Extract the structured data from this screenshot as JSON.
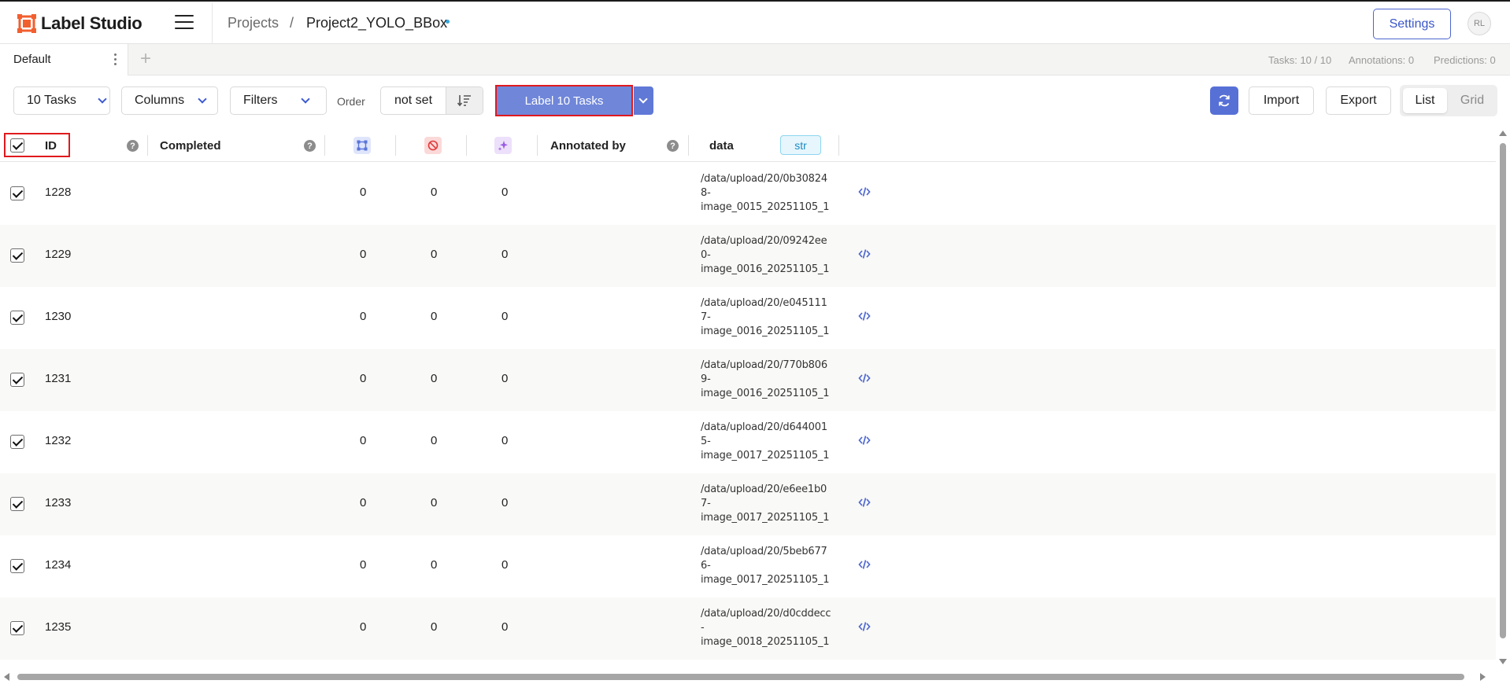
{
  "app": {
    "logo_text": "Label Studio",
    "brand_color": "#f25f2f",
    "accent_color": "#5770d6"
  },
  "header": {
    "breadcrumb_projects": "Projects",
    "breadcrumb_separator": "/",
    "project_name": "Project2_YOLO_BBox",
    "settings_label": "Settings",
    "avatar_initials": "RL"
  },
  "tabs": {
    "active_label": "Default",
    "add_label": "+",
    "stats": {
      "tasks": "Tasks: 10 / 10",
      "annotations": "Annotations: 0",
      "predictions": "Predictions: 0"
    }
  },
  "toolbar": {
    "tasks_label": "10 Tasks",
    "columns_label": "Columns",
    "filters_label": "Filters",
    "order_label": "Order",
    "order_value": "not set",
    "label_button": "Label 10 Tasks",
    "import_label": "Import",
    "export_label": "Export",
    "view_list": "List",
    "view_grid": "Grid",
    "active_view": "List"
  },
  "table": {
    "columns": {
      "id": "ID",
      "completed": "Completed",
      "annotated_by": "Annotated by",
      "data": "data",
      "data_type": "str",
      "help_glyph": "?"
    },
    "column_icons": [
      "annotations-count-icon",
      "cancelled-count-icon",
      "predictions-count-icon"
    ],
    "rows": [
      {
        "id": "1228",
        "total": "0",
        "cancelled": "0",
        "predictions": "0",
        "data": [
          "/data/upload/20/0b30824",
          "8-",
          "image_0015_20251105_1"
        ],
        "checked": true
      },
      {
        "id": "1229",
        "total": "0",
        "cancelled": "0",
        "predictions": "0",
        "data": [
          "/data/upload/20/09242ee",
          "0-",
          "image_0016_20251105_1"
        ],
        "checked": true
      },
      {
        "id": "1230",
        "total": "0",
        "cancelled": "0",
        "predictions": "0",
        "data": [
          "/data/upload/20/e045111",
          "7-",
          "image_0016_20251105_1"
        ],
        "checked": true
      },
      {
        "id": "1231",
        "total": "0",
        "cancelled": "0",
        "predictions": "0",
        "data": [
          "/data/upload/20/770b806",
          "9-",
          "image_0016_20251105_1"
        ],
        "checked": true
      },
      {
        "id": "1232",
        "total": "0",
        "cancelled": "0",
        "predictions": "0",
        "data": [
          "/data/upload/20/d644001",
          "5-",
          "image_0017_20251105_1"
        ],
        "checked": true
      },
      {
        "id": "1233",
        "total": "0",
        "cancelled": "0",
        "predictions": "0",
        "data": [
          "/data/upload/20/e6ee1b0",
          "7-",
          "image_0017_20251105_1"
        ],
        "checked": true
      },
      {
        "id": "1234",
        "total": "0",
        "cancelled": "0",
        "predictions": "0",
        "data": [
          "/data/upload/20/5beb677",
          "6-",
          "image_0017_20251105_1"
        ],
        "checked": true
      },
      {
        "id": "1235",
        "total": "0",
        "cancelled": "0",
        "predictions": "0",
        "data": [
          "/data/upload/20/d0cddecc",
          "-",
          "image_0018_20251105_1"
        ],
        "checked": true
      }
    ]
  }
}
